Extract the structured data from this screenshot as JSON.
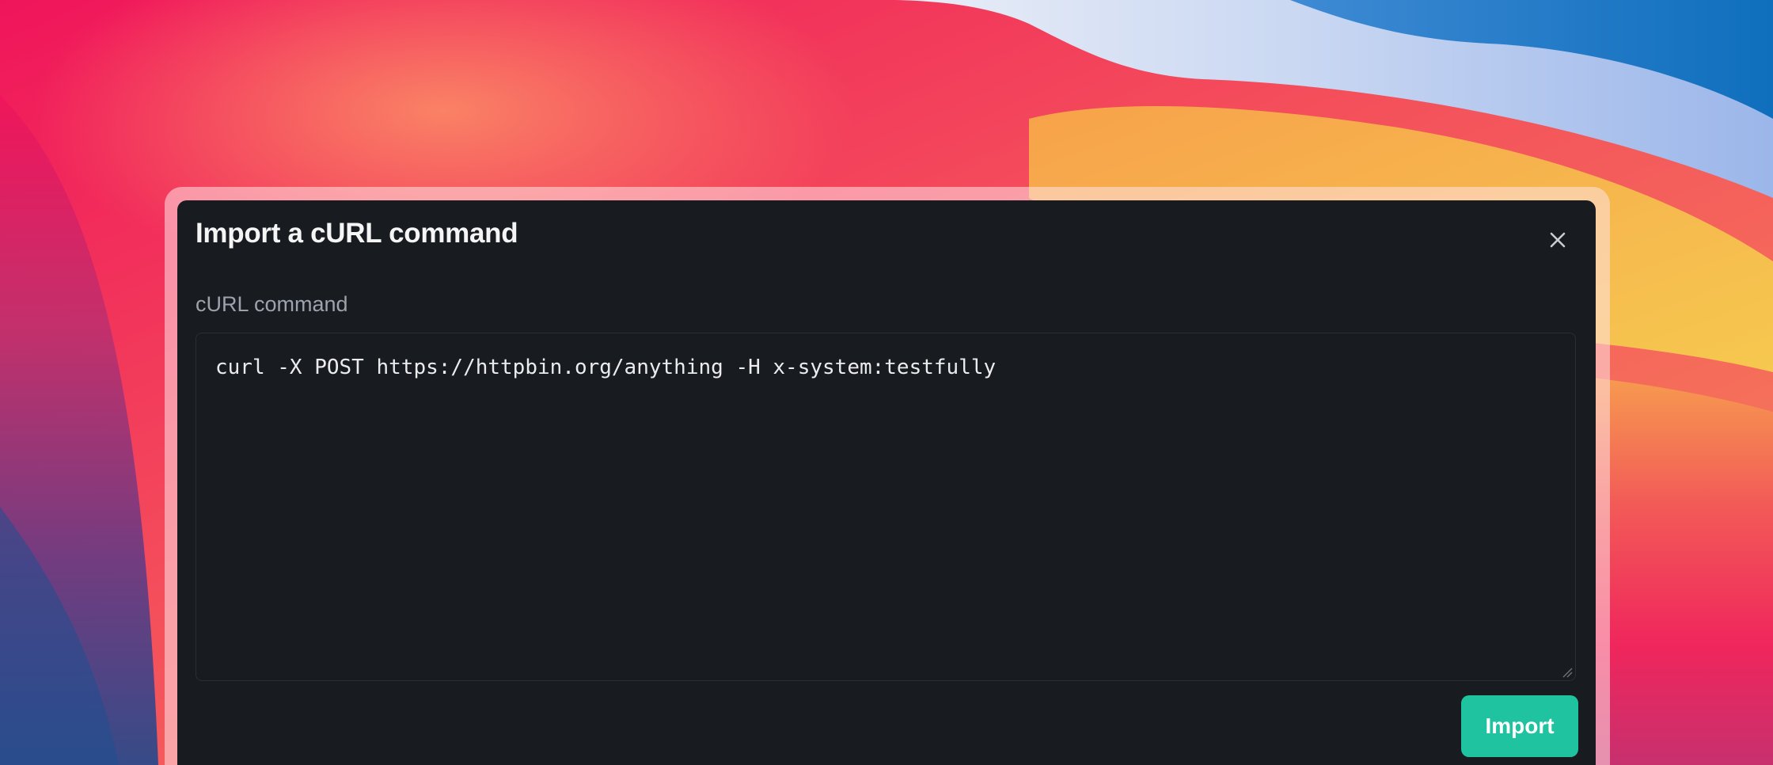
{
  "dialog": {
    "title": "Import a cURL command",
    "close_icon": "close-icon",
    "field_label": "cURL command",
    "command_value": "curl -X POST https://httpbin.org/anything -H x-system:testfully",
    "import_label": "Import"
  },
  "colors": {
    "dialog_background": "#181b1f",
    "accent": "#1fc39f",
    "label_text": "#9da3ad",
    "title_text": "#f5f5f6"
  }
}
